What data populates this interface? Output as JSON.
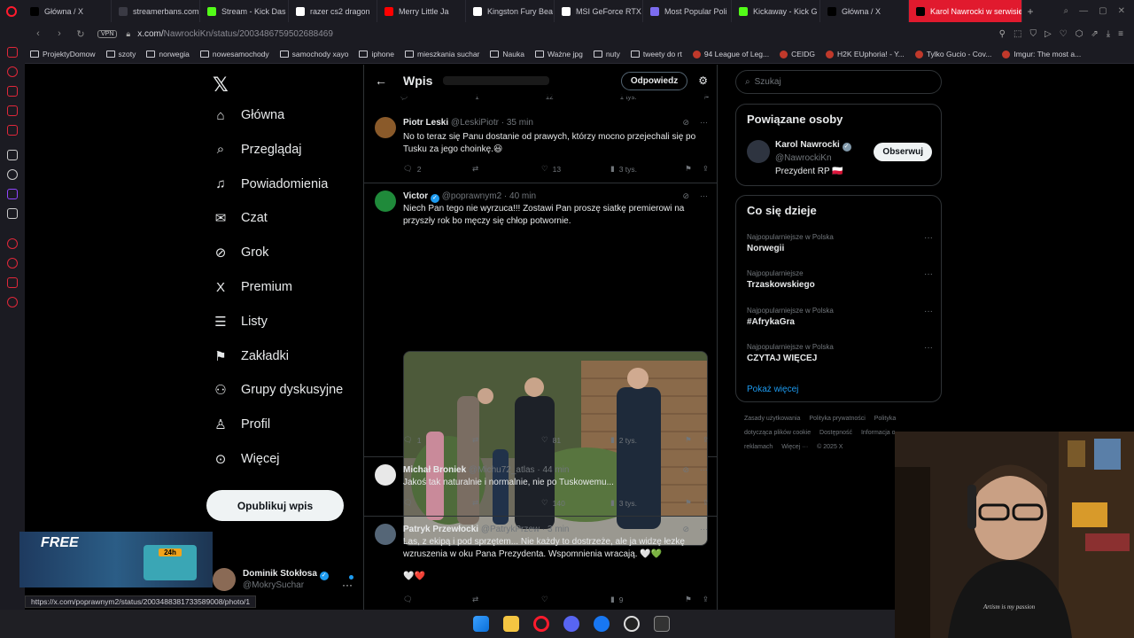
{
  "browser": {
    "tabs": [
      {
        "label": "Główna / X",
        "icon_color": "#000000",
        "icon": "x-icon"
      },
      {
        "label": "streamerbans.com",
        "icon_color": "#3a3a44",
        "icon": "page-icon"
      },
      {
        "label": "Stream - Kick Das",
        "icon_color": "#53fc18",
        "icon": "kick-icon"
      },
      {
        "label": "razer cs2 dragon",
        "icon_color": "#ffffff",
        "icon": "google-icon"
      },
      {
        "label": "Merry Little Ja",
        "icon_color": "#ff0000",
        "icon": "youtube-icon"
      },
      {
        "label": "Kingston Fury Bea",
        "icon_color": "#ffffff",
        "icon": "k-icon"
      },
      {
        "label": "MSI GeForce RTX",
        "icon_color": "#ffffff",
        "icon": "m-icon"
      },
      {
        "label": "Most Popular Poli",
        "icon_color": "#7c6cf0",
        "icon": "globe-icon"
      },
      {
        "label": "Kickaway - Kick G",
        "icon_color": "#53fc18",
        "icon": "kick-icon"
      },
      {
        "label": "Główna / X",
        "icon_color": "#000000",
        "icon": "x-icon"
      },
      {
        "label": "Karol Nawrocki w serwisie",
        "icon_color": "#000000",
        "icon": "x-icon",
        "active": true
      }
    ],
    "url_host": "x.com/",
    "url_path": "NawrockiKn/status/2003486759502688469",
    "vpn_label": "VPN",
    "bookmarks": [
      {
        "label": "ProjektyDomow",
        "type": "folder"
      },
      {
        "label": "szoty",
        "type": "folder"
      },
      {
        "label": "norwegia",
        "type": "folder"
      },
      {
        "label": "nowesamochody",
        "type": "folder"
      },
      {
        "label": "samochody xayo",
        "type": "folder"
      },
      {
        "label": "iphone",
        "type": "folder"
      },
      {
        "label": "mieszkania suchar",
        "type": "folder"
      },
      {
        "label": "Nauka",
        "type": "folder"
      },
      {
        "label": "Ważne jpg",
        "type": "folder"
      },
      {
        "label": "nuty",
        "type": "folder"
      },
      {
        "label": "tweety do rt",
        "type": "folder"
      },
      {
        "label": "94 League of Leg...",
        "type": "site"
      },
      {
        "label": "CEIDG",
        "type": "site"
      },
      {
        "label": "H2K EUphoria! - Y...",
        "type": "site"
      },
      {
        "label": "Tylko Gucio - Cov...",
        "type": "site"
      },
      {
        "label": "Imgur: The most a...",
        "type": "site"
      }
    ],
    "status_url": "https://x.com/poprawnym2/status/2003488381733589008/photo/1"
  },
  "nav": {
    "items": [
      {
        "label": "Główna",
        "icon": "home-icon",
        "glyph": "⌂"
      },
      {
        "label": "Przeglądaj",
        "icon": "search-icon",
        "glyph": "⌕"
      },
      {
        "label": "Powiadomienia",
        "icon": "bell-icon",
        "glyph": "♫"
      },
      {
        "label": "Czat",
        "icon": "mail-icon",
        "glyph": "✉"
      },
      {
        "label": "Grok",
        "icon": "grok-icon",
        "glyph": "⊘"
      },
      {
        "label": "Premium",
        "icon": "x-premium-icon",
        "glyph": "X"
      },
      {
        "label": "Listy",
        "icon": "list-icon",
        "glyph": "☰"
      },
      {
        "label": "Zakładki",
        "icon": "bookmark-icon",
        "glyph": "⚑"
      },
      {
        "label": "Grupy dyskusyjne",
        "icon": "people-icon",
        "glyph": "⚇"
      },
      {
        "label": "Profil",
        "icon": "profile-icon",
        "glyph": "♙"
      },
      {
        "label": "Więcej",
        "icon": "more-icon",
        "glyph": "⊙"
      }
    ],
    "publish_label": "Opublikuj wpis",
    "user": {
      "name": "Dominik Stokłosa",
      "handle": "@MokrySuchar"
    }
  },
  "main": {
    "title": "Wpis",
    "reply_label": "Odpowiedz",
    "prev_counts": {
      "retweets": "1",
      "likes": "12",
      "views": "1 tys."
    },
    "tweets": [
      {
        "name": "Piotr Leski",
        "verified": false,
        "handle": "@LeskiPiotr",
        "time": "· 35 min",
        "text": "No to teraz się Panu dostanie od prawych, którzy mocno przejechali się po Tusku za jego choinkę.😃",
        "replies": "2",
        "retweets": "",
        "likes": "13",
        "views": "3 tys.",
        "avatar_color": "#8a5a2a"
      },
      {
        "name": "Victor",
        "verified": true,
        "handle": "@poprawnym2",
        "time": "· 40 min",
        "text": "Niech Pan tego nie wyrzuca!!! Zostawi Pan proszę siatkę premierowi na przyszły rok bo męczy się chłop potwornie.",
        "replies": "1",
        "retweets": "",
        "likes": "81",
        "views": "2 tys.",
        "avatar_color": "#1f8a3a"
      },
      {
        "name": "Michał Broniek",
        "verified": false,
        "handle": "@Michu72_atlas",
        "time": "· 44 min",
        "text": "Jakoś tak naturalnie i normalnie, nie po Tuskowemu...",
        "replies": "",
        "retweets": "",
        "likes": "140",
        "views": "3 tys.",
        "avatar_color": "#e8e8e8"
      },
      {
        "name": "Patryk Przewłocki",
        "verified": false,
        "handle": "@PatrykPrzew",
        "time": "· 3 min",
        "text": "Las, z ekipą i pod sprzętem... Nie każdy to dostrzeże, ale ja widzę łezkę wzruszenia w oku Pana Prezydenta. Wspomnienia wracają. 🤍💚",
        "text2": "🤍❤️",
        "replies": "",
        "retweets": "",
        "likes": "",
        "views": "9",
        "avatar_color": "#556677"
      }
    ]
  },
  "right": {
    "search_placeholder": "Szukaj",
    "related_title": "Powiązane osoby",
    "person": {
      "name": "Karol Nawrocki",
      "handle": "@NawrockiKn",
      "bio": "Prezydent RP 🇵🇱"
    },
    "follow_label": "Obserwuj",
    "trends_title": "Co się dzieje",
    "trends": [
      {
        "context": "Najpopularniejsze w Polska",
        "topic": "Norwegii"
      },
      {
        "context": "Najpopularniejsze",
        "topic": "Trzaskowskiego"
      },
      {
        "context": "Najpopularniejsze w Polska",
        "topic": "#AfrykaGra"
      },
      {
        "context": "Najpopularniejsze w Polska",
        "topic": "CZYTAJ WIĘCEJ"
      }
    ],
    "show_more": "Pokaż więcej",
    "footer": [
      "Zasady użytkowania",
      "Polityka prywatności",
      "Polityka dotycząca plików cookie",
      "Dostępność",
      "Informacja o reklamach",
      "Więcej ···",
      "© 2025 X"
    ]
  },
  "overlay": {
    "promo_text": "FREE",
    "promo_badge": "24h"
  }
}
